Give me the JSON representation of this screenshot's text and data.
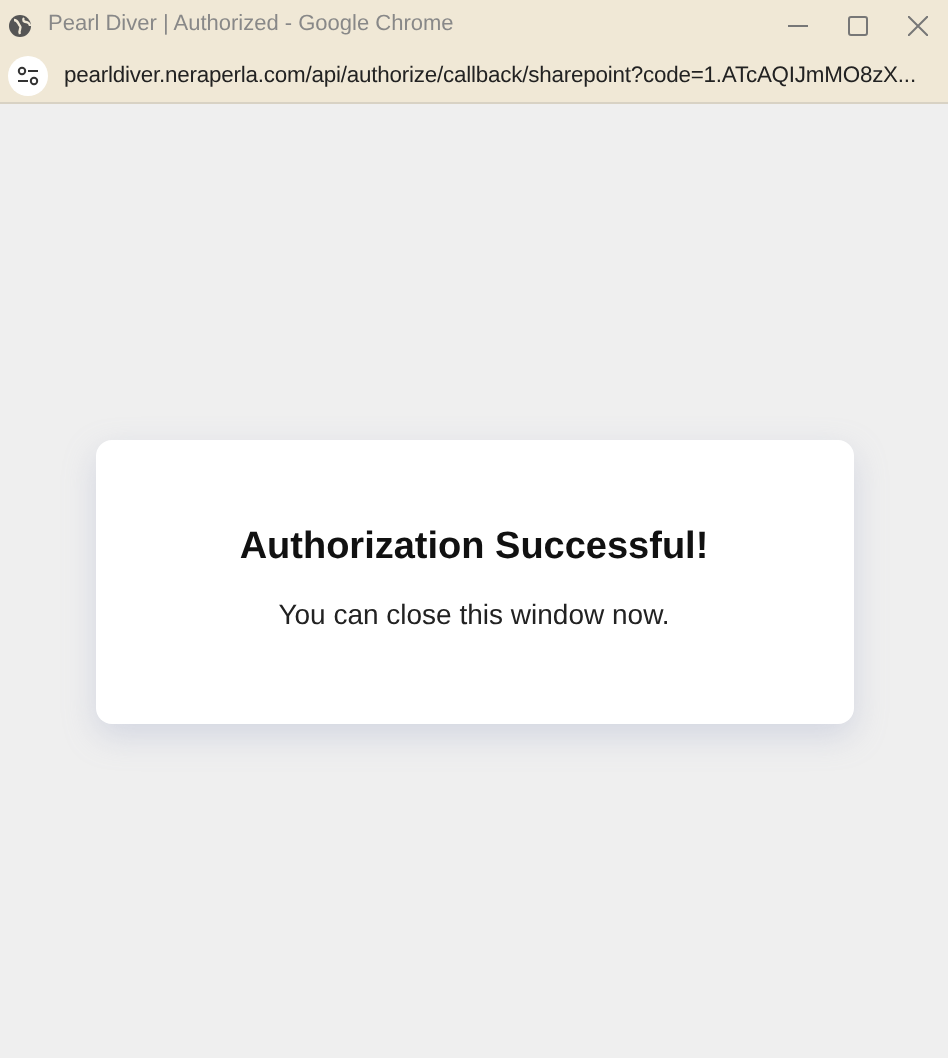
{
  "window": {
    "title": "Pearl Diver | Authorized - Google Chrome"
  },
  "address_bar": {
    "url": "pearldiver.neraperla.com/api/authorize/callback/sharepoint?code=1.ATcAQIJmMO8zX..."
  },
  "card": {
    "heading": "Authorization Successful!",
    "message": "You can close this window now."
  }
}
